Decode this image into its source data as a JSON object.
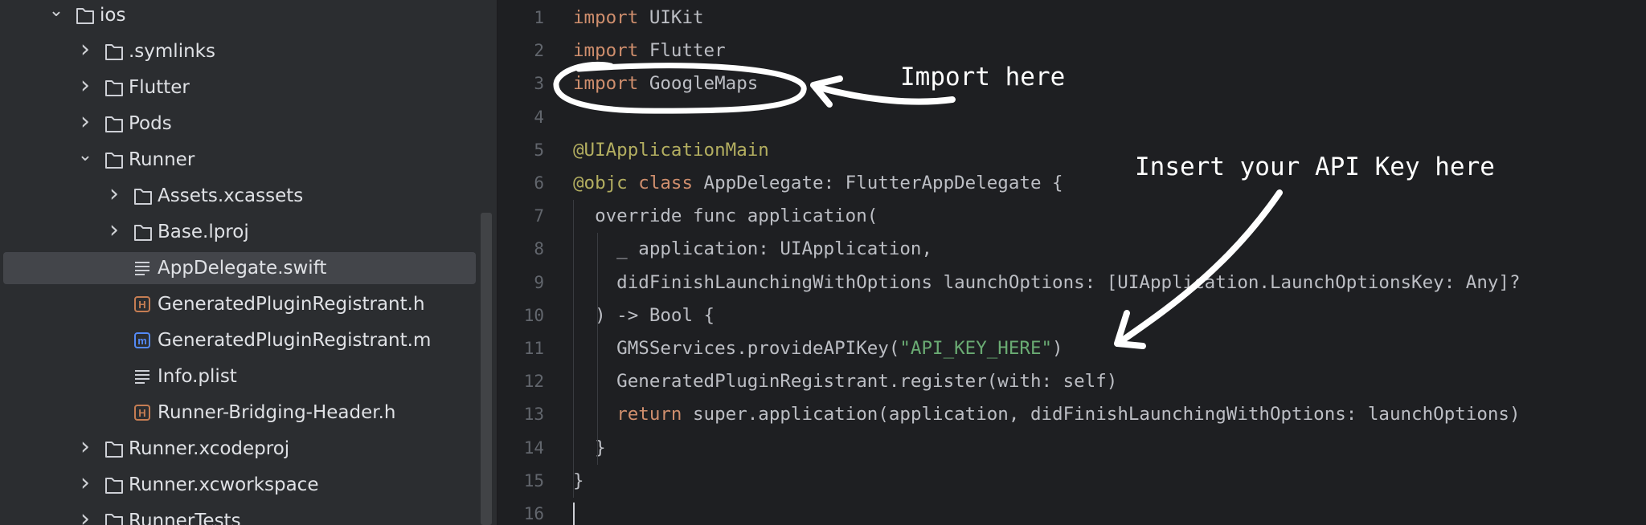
{
  "project_tree": {
    "items": [
      {
        "label": "ios",
        "icon": "folder-icon",
        "chevron": "down",
        "expanded": true
      },
      {
        "label": ".symlinks",
        "icon": "folder-icon",
        "chevron": "right"
      },
      {
        "label": "Flutter",
        "icon": "folder-icon",
        "chevron": "right"
      },
      {
        "label": "Pods",
        "icon": "folder-icon",
        "chevron": "right"
      },
      {
        "label": "Runner",
        "icon": "folder-icon",
        "chevron": "down",
        "expanded": true
      },
      {
        "label": "Assets.xcassets",
        "icon": "folder-icon",
        "chevron": "right"
      },
      {
        "label": "Base.lproj",
        "icon": "folder-icon",
        "chevron": "right"
      },
      {
        "label": "AppDelegate.swift",
        "icon": "text-file-icon",
        "selected": true
      },
      {
        "label": "GeneratedPluginRegistrant.h",
        "icon": "header-file-icon",
        "badge": "H"
      },
      {
        "label": "GeneratedPluginRegistrant.m",
        "icon": "objc-file-icon",
        "badge": "m"
      },
      {
        "label": "Info.plist",
        "icon": "text-file-icon"
      },
      {
        "label": "Runner-Bridging-Header.h",
        "icon": "header-file-icon",
        "badge": "H"
      },
      {
        "label": "Runner.xcodeproj",
        "icon": "folder-icon",
        "chevron": "right"
      },
      {
        "label": "Runner.xcworkspace",
        "icon": "folder-icon",
        "chevron": "right"
      },
      {
        "label": "RunnerTests",
        "icon": "folder-icon",
        "chevron": "right"
      }
    ]
  },
  "editor": {
    "lines": [
      {
        "num": "1",
        "tokens": [
          {
            "t": "import",
            "c": "kw"
          },
          {
            "t": " UIKit"
          }
        ]
      },
      {
        "num": "2",
        "tokens": [
          {
            "t": "import",
            "c": "kw"
          },
          {
            "t": " Flutter"
          }
        ]
      },
      {
        "num": "3",
        "tokens": [
          {
            "t": "import",
            "c": "kw"
          },
          {
            "t": " GoogleMaps"
          }
        ]
      },
      {
        "num": "4",
        "tokens": []
      },
      {
        "num": "5",
        "tokens": [
          {
            "t": "@UIApplicationMain",
            "c": "ann"
          }
        ]
      },
      {
        "num": "6",
        "tokens": [
          {
            "t": "@objc",
            "c": "ann"
          },
          {
            "t": " "
          },
          {
            "t": "class",
            "c": "kw"
          },
          {
            "t": " AppDelegate: FlutterAppDelegate {"
          }
        ]
      },
      {
        "num": "7",
        "tokens": [
          {
            "t": "  override func application("
          }
        ]
      },
      {
        "num": "8",
        "tokens": [
          {
            "t": "    _ application: UIApplication,"
          }
        ]
      },
      {
        "num": "9",
        "tokens": [
          {
            "t": "    didFinishLaunchingWithOptions launchOptions: [UIApplication.LaunchOptionsKey: Any]?"
          }
        ]
      },
      {
        "num": "10",
        "tokens": [
          {
            "t": "  ) -> Bool {"
          }
        ]
      },
      {
        "num": "11",
        "tokens": [
          {
            "t": "    GMSServices.provideAPIKey("
          },
          {
            "t": "\"API_KEY_HERE\"",
            "c": "str"
          },
          {
            "t": ")"
          }
        ]
      },
      {
        "num": "12",
        "tokens": [
          {
            "t": "    GeneratedPluginRegistrant.register(with: self)"
          }
        ]
      },
      {
        "num": "13",
        "tokens": [
          {
            "t": "    "
          },
          {
            "t": "return",
            "c": "kw"
          },
          {
            "t": " super.application(application, didFinishLaunchingWithOptions: launchOptions)"
          }
        ]
      },
      {
        "num": "14",
        "tokens": [
          {
            "t": "  }"
          }
        ]
      },
      {
        "num": "15",
        "tokens": [
          {
            "t": "}"
          }
        ]
      },
      {
        "num": "16",
        "tokens": []
      }
    ]
  },
  "annotations": {
    "import_note": "Import here",
    "api_key_note": "Insert your API Key here"
  },
  "colors": {
    "sidebar_bg": "#2b2d30",
    "editor_bg": "#1e1f22",
    "keyword": "#cf8e6d",
    "annotation": "#b3ae60",
    "string": "#6aab73",
    "folder_icon": "#ced0d6",
    "header_badge": "#c57d53",
    "objc_badge": "#548af7"
  }
}
